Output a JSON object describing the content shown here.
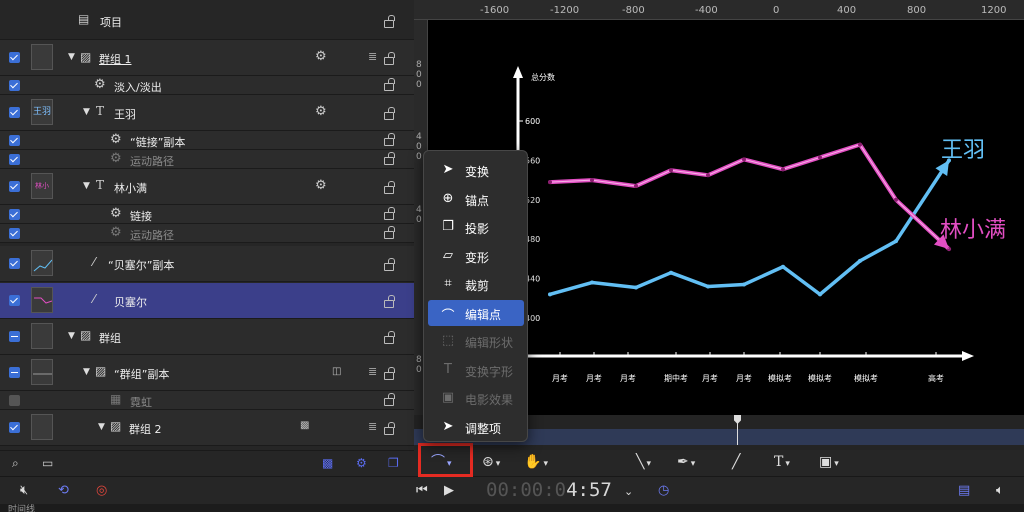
{
  "layers": {
    "header_label": "项目",
    "rows": [
      {
        "label": "群组 1"
      },
      {
        "label": "淡入/淡出"
      },
      {
        "label": "王羽",
        "thumb": "王羽"
      },
      {
        "label": "“链接”副本"
      },
      {
        "label": "运动路径"
      },
      {
        "label": "林小满",
        "thumb": "林小满"
      },
      {
        "label": "链接"
      },
      {
        "label": "运动路径"
      },
      {
        "label": "“贝塞尔”副本"
      },
      {
        "label": "贝塞尔"
      },
      {
        "label": "群组"
      },
      {
        "label": "“群组”副本"
      },
      {
        "label": "霓虹"
      },
      {
        "label": "群组 2"
      }
    ]
  },
  "ruler": {
    "top": [
      "-1600",
      "-1200",
      "-800",
      "-400",
      "0",
      "400",
      "800",
      "1200"
    ],
    "left_top": [
      "8",
      "0",
      "0"
    ],
    "left_mid": [
      "4",
      "0",
      "0"
    ],
    "left_low": [
      "4",
      "0"
    ],
    "left_bottom": [
      "8",
      "0"
    ]
  },
  "chart_data": {
    "type": "line",
    "ylabel": "总分数",
    "y_ticks": [
      "600",
      "560",
      "520",
      "480",
      "440",
      "400"
    ],
    "x_labels": [
      "月考",
      "月考",
      "月考",
      "期中考",
      "月考",
      "月考",
      "模拟考",
      "模拟考",
      "模拟考",
      "高考"
    ],
    "series": [
      {
        "name": "王羽",
        "color": "#62bff4",
        "values": [
          424,
          436,
          431,
          446,
          432,
          434,
          452,
          424,
          458,
          478,
          560
        ]
      },
      {
        "name": "林小满",
        "color": "#e24ec3",
        "values": [
          538,
          540,
          534,
          550,
          545,
          561,
          551,
          563,
          576,
          520,
          470
        ]
      }
    ]
  },
  "menu": {
    "items": [
      {
        "label": "变换",
        "icon": "pointer-icon",
        "glyph": "➤",
        "enabled": true
      },
      {
        "label": "锚点",
        "icon": "anchor-icon",
        "glyph": "⊕",
        "enabled": true
      },
      {
        "label": "投影",
        "icon": "drop-shadow-icon",
        "glyph": "❐",
        "enabled": true
      },
      {
        "label": "变形",
        "icon": "distort-icon",
        "glyph": "▱",
        "enabled": true
      },
      {
        "label": "裁剪",
        "icon": "crop-icon",
        "glyph": "⌗",
        "enabled": true
      },
      {
        "label": "编辑点",
        "icon": "edit-points-icon",
        "glyph": "⌒",
        "enabled": true,
        "selected": true
      },
      {
        "label": "编辑形状",
        "icon": "edit-shape-icon",
        "glyph": "⬚",
        "enabled": false
      },
      {
        "label": "变换字形",
        "icon": "transform-glyph-icon",
        "glyph": "T",
        "enabled": false
      },
      {
        "label": "电影效果",
        "icon": "cinematic-icon",
        "glyph": "▣",
        "enabled": false
      },
      {
        "label": "调整项",
        "icon": "adjust-item-icon",
        "glyph": "➤",
        "enabled": true
      }
    ]
  },
  "transport": {
    "timecode_dim": "00:00:0",
    "timecode_bright": "4:57"
  },
  "bottom": {
    "label": "时间线"
  }
}
